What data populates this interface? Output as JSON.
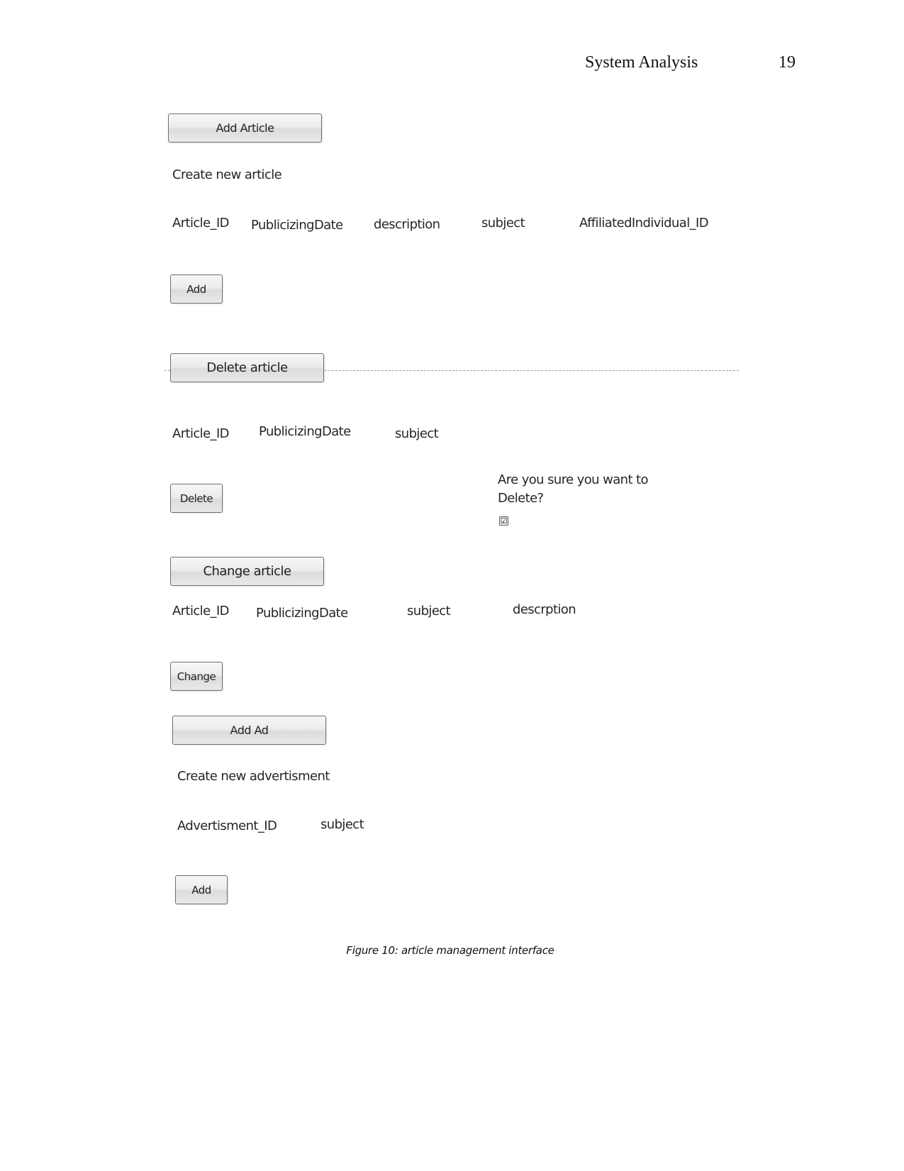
{
  "header": {
    "running_title": "System Analysis",
    "page_number": "19"
  },
  "figure": {
    "add_article": {
      "button_label": "Add Article",
      "description": "Create new article",
      "fields": [
        "Article_ID",
        "PublicizingDate",
        "description",
        "subject",
        "AffiliatedIndividual_ID"
      ],
      "submit_label": "Add"
    },
    "delete_article": {
      "button_label": "Delete article",
      "fields": [
        "Article_ID",
        "PublicizingDate",
        "subject"
      ],
      "submit_label": "Delete",
      "confirm_text_line1": "Are you sure you want to",
      "confirm_text_line2": "Delete?",
      "confirm_checked": true,
      "checkbox_glyph": "☑"
    },
    "change_article": {
      "button_label": "Change article",
      "fields": [
        "Article_ID",
        "PublicizingDate",
        "subject",
        "descrption"
      ],
      "submit_label": "Change"
    },
    "add_ad": {
      "button_label": "Add Ad",
      "description": "Create new advertisment",
      "fields": [
        "Advertisment_ID",
        "subject"
      ],
      "submit_label": "Add"
    }
  },
  "caption": "Figure 10: article management interface"
}
